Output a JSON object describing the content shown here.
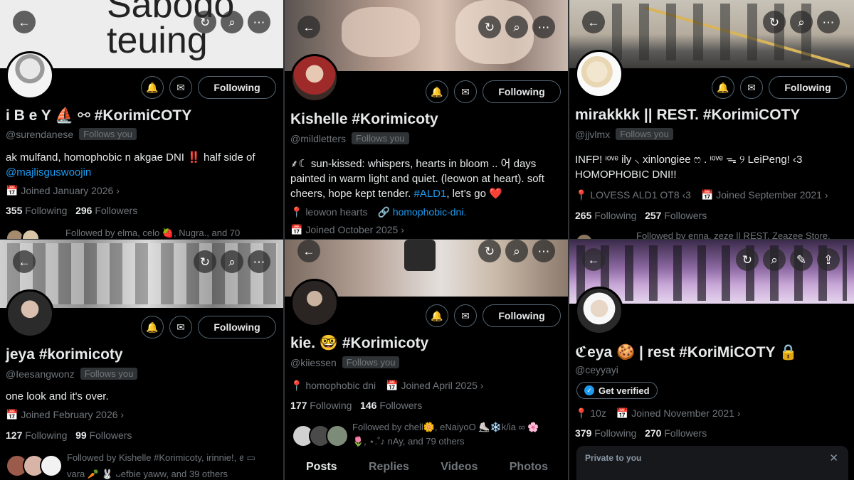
{
  "ui": {
    "back": "←",
    "sync": "↻",
    "search": "⌕",
    "more": "⋯",
    "notify": "🔔",
    "message": "✉",
    "edit": "✎",
    "share": "⇪",
    "close": "✕",
    "chevron": "›"
  },
  "p1": {
    "banner_text": "Sabodo teuing",
    "name": "i B e Y ⛵ ⚯ #KorimiCOTY",
    "handle": "@surendanese",
    "follows_you": "Follows you",
    "bio_text": "ak mulfand, homophobic n akgae DNI ‼️ half side of",
    "bio_link": "@majlisguswoojin",
    "joined": "📅 Joined January 2026 ›",
    "following_count": "355",
    "following_label": "Following",
    "followers_count": "296",
    "followers_label": "Followers",
    "followed_by": "Followed by elma, celo 🍓, Nugra., and 70",
    "follow_btn": "Following"
  },
  "p2": {
    "name": "Kishelle #Korimicoty",
    "handle": "@mildletters",
    "follows_you": "Follows you",
    "bio_text": "⸙☾ sun-kissed: whispers, hearts in bloom .. 어 days painted in warm light and quiet. (leowon at heart). soft cheers, hope kept tender.",
    "bio_link": "#ALD1",
    "bio_tail": ", let’s go ❤️",
    "location": "📍 leowon hearts",
    "website": "🔗 homophobic-dni.",
    "joined": "📅 Joined October 2025 ›",
    "follow_btn": "Following"
  },
  "p3": {
    "name": "mirakkkk || REST. #KorimiCOTY",
    "handle": "@jjvlmx",
    "follows_you": "Follows you",
    "bio_text": "INFP! ᶦᵒᵛᵉ ily ⸜ xinlongiee ෆ . ᶦᵒᵛᵉ ᯓ ୨ LeiPeng! ‹3 HOMOPHOBIC DNI!!",
    "location": "📍 LOVESS ALD1 OT8 ‹3",
    "joined": "📅 Joined September 2021 ›",
    "following_count": "265",
    "following_label": "Following",
    "followers_count": "257",
    "followers_label": "Followers",
    "followed_by": "Followed by enna, zeze || REST, Zeazee Store,",
    "follow_btn": "Following"
  },
  "p4": {
    "name": "jeya #korimicoty",
    "handle": "@Ieesangwonz",
    "follows_you": "Follows you",
    "bio_text": "one look and it's over.",
    "joined": "📅 Joined February 2026 ›",
    "following_count": "127",
    "following_label": "Following",
    "followers_count": "99",
    "followers_label": "Followers",
    "followed_by_1": "Followed by Kishelle #Korimicoty, irinnie!, ꫀ ▭",
    "followed_by_2": "vara 🥕 🐰 ᴗefbie yaww, and 39 others",
    "follow_btn": "Following"
  },
  "p5": {
    "name": "kie. 🤓 #Korimicoty",
    "handle": "@kiiessen",
    "follows_you": "Follows you",
    "location": "📍 homophobic dni",
    "joined": "📅 Joined April 2025 ›",
    "following_count": "177",
    "following_label": "Following",
    "followers_count": "146",
    "followers_label": "Followers",
    "followed_by_1": "Followed by chell🌼, eNaiyoO ⛸️❄️k/ia ∞ 🌸",
    "followed_by_2": "🌷, ⋆.˚♪ nAy, and 79 others",
    "tabs": [
      "Posts",
      "Replies",
      "Videos",
      "Photos"
    ],
    "follow_btn": "Following"
  },
  "p6": {
    "name": "ℭeya 🍪 | rest #KoriMiCOTY 🔒",
    "handle": "@ceyyayi",
    "verify": "Get verified",
    "location": "📍 10z",
    "joined": "📅 Joined November 2021 ›",
    "following_count": "379",
    "following_label": "Following",
    "followers_count": "270",
    "followers_label": "Followers",
    "private_label": "Private to you"
  },
  "colors": {
    "accent": "#1d9bf0",
    "muted": "#71767b",
    "text": "#e7e9ea",
    "heart": "#f91880"
  }
}
